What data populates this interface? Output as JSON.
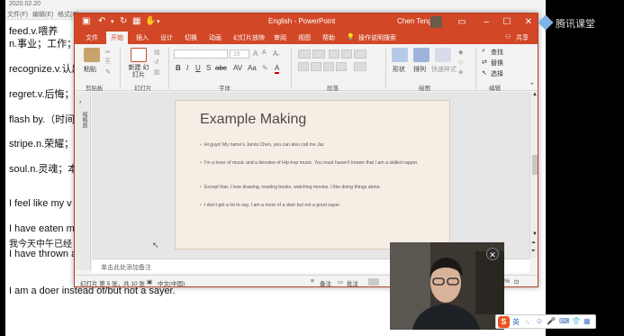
{
  "background_document": {
    "topbar": {
      "date": "2020.02.20",
      "file_menu": "文件(F)",
      "edit_menu": "编辑(E)",
      "format_menu": "格式(O)"
    },
    "notes": [
      "feed.v.喂养",
      "n.事业；工作；",
      "recognize.v.认出",
      "regret.v.后悔；",
      "flash by.（时间",
      "stripe.n.荣耀；",
      "soul.n.灵魂；本",
      "I feel like my v",
      "I have eaten m",
      "我今天中午已经",
      "I have thrown a",
      "I am a doer instead of/but not a sayer."
    ]
  },
  "powerpoint": {
    "window_title": "English - PowerPoint",
    "user_name": "Chen Teng",
    "tabs": [
      "文件",
      "开始",
      "插入",
      "设计",
      "切换",
      "动画",
      "幻灯片放映",
      "审阅",
      "视图",
      "帮助"
    ],
    "active_tab": "开始",
    "tell_me": "操作说明搜索",
    "share": "共享",
    "ribbon": {
      "paste": "粘贴",
      "new_slide": "新建 幻灯片",
      "groups": [
        "剪贴板",
        "幻灯片",
        "字体",
        "段落",
        "绘图",
        "编辑"
      ],
      "font_size": "15",
      "shape": "形状",
      "arrange": "排列",
      "quick_styles": "快速样式",
      "find": "查找",
      "replace": "替换",
      "select": "选择"
    },
    "left_pane_label": "缩略图",
    "slide": {
      "title": "Example Making",
      "bullets": [
        "Hi guys! My name’s Jarvis Chen, you can also call me Jar.",
        "I’m a lover of music and a devotee of Hip-hop music. You must haven’t known that I am a skilled rapper.",
        "Except that, I love drawing, reading books, watching movies. I like doing things alone.",
        "I don’t get a lot to say, I am a more of a doer but not a good sayer."
      ]
    },
    "notes_placeholder": "单击此处添加备注",
    "status": {
      "slide_counter": "幻灯片 第 5 张，共 10 张",
      "language": "中文(中国)",
      "notes": "备注",
      "comments": "批注",
      "zoom": "47%"
    }
  },
  "overlay": {
    "brand": "腾讯课堂",
    "ime": {
      "logo": "S",
      "lang": "英"
    }
  }
}
